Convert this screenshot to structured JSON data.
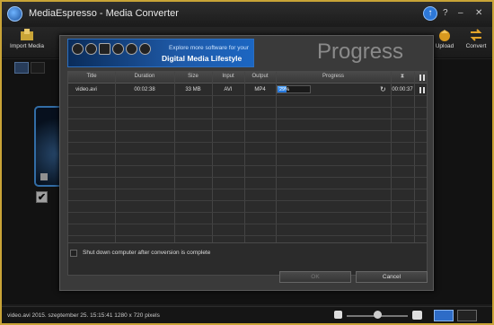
{
  "window": {
    "title": "MediaEspresso - Media Converter",
    "minimize": "–",
    "help": "?",
    "close": "✕",
    "update_icon": "up-arrow-icon"
  },
  "toolbar": {
    "import_label": "Import Media",
    "upload_label": "Upload",
    "convert_label": "Convert"
  },
  "media": {
    "filename": "video.avi",
    "checked": true,
    "check_glyph": "✔"
  },
  "status": {
    "text": "video.avi  2015. szeptember 25. 15:15:41  1280 x 720 pixels"
  },
  "dialog": {
    "title": "Progress",
    "banner_line1": "Explore more software for your",
    "banner_line2": "Digital Media Lifestyle",
    "columns": [
      "Title",
      "Duration",
      "Size",
      "Input",
      "Output",
      "Progress",
      "⧗"
    ],
    "rows": [
      {
        "title": "video.avi",
        "duration": "00:02:38",
        "size": "33 MB",
        "input": "AVI",
        "output": "MP4",
        "progress_text": "29%",
        "progress": 0.29,
        "remaining": "00:00:37"
      }
    ],
    "shutdown_label": "Shut down computer after conversion is complete",
    "ok_label": "OK",
    "cancel_label": "Cancel"
  },
  "colors": {
    "accent": "#2e6cc7",
    "frame": "#c9a437"
  }
}
